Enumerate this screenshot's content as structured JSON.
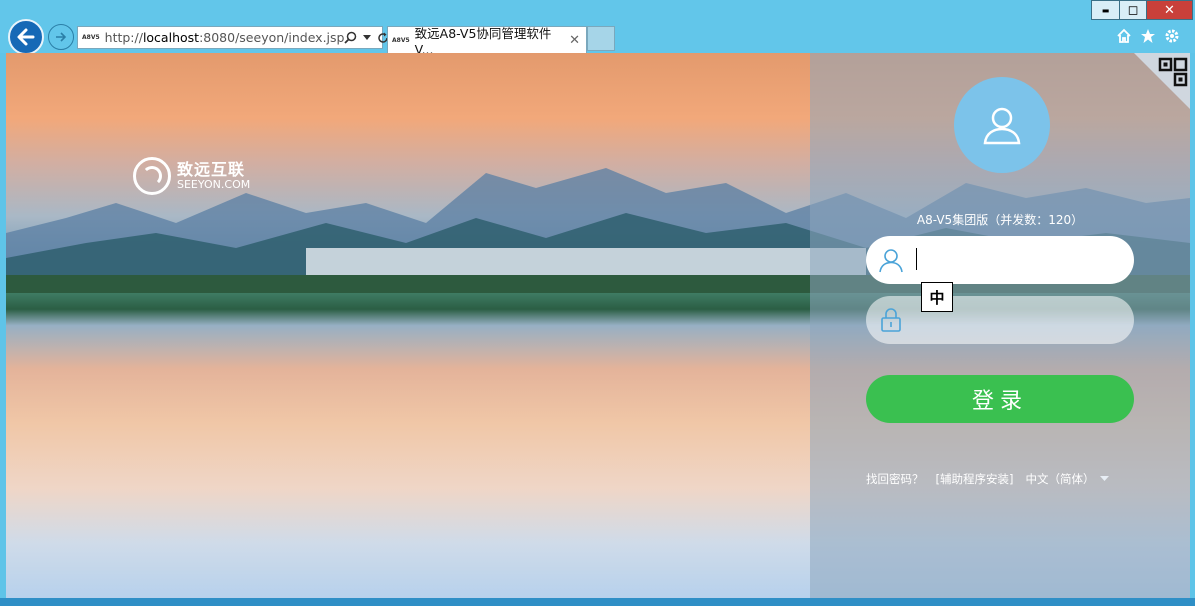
{
  "browser": {
    "url_prefix": "http://",
    "url_host": "localhost",
    "url_rest": ":8080/seeyon/index.jsp",
    "favicon_text": "A8V5",
    "tab_title": "致远A8-V5协同管理软件 V...",
    "tab_close": "✕",
    "window": {
      "minimize": "▬",
      "maximize": "◻",
      "close": "✕"
    }
  },
  "brand": {
    "name_cn": "致远互联",
    "name_en": "SEEYON.COM"
  },
  "login": {
    "edition": "A8-V5集团版（并发数：120）",
    "username_value": "",
    "password_value": "",
    "ime_indicator": "中",
    "login_label": "登录",
    "forgot_password": "找回密码？",
    "helper_install": "[辅助程序安装]",
    "language": "中文（简体）"
  },
  "colors": {
    "chrome": "#62c6ea",
    "login_button": "#3ac050",
    "avatar": "#7cc3ea"
  }
}
